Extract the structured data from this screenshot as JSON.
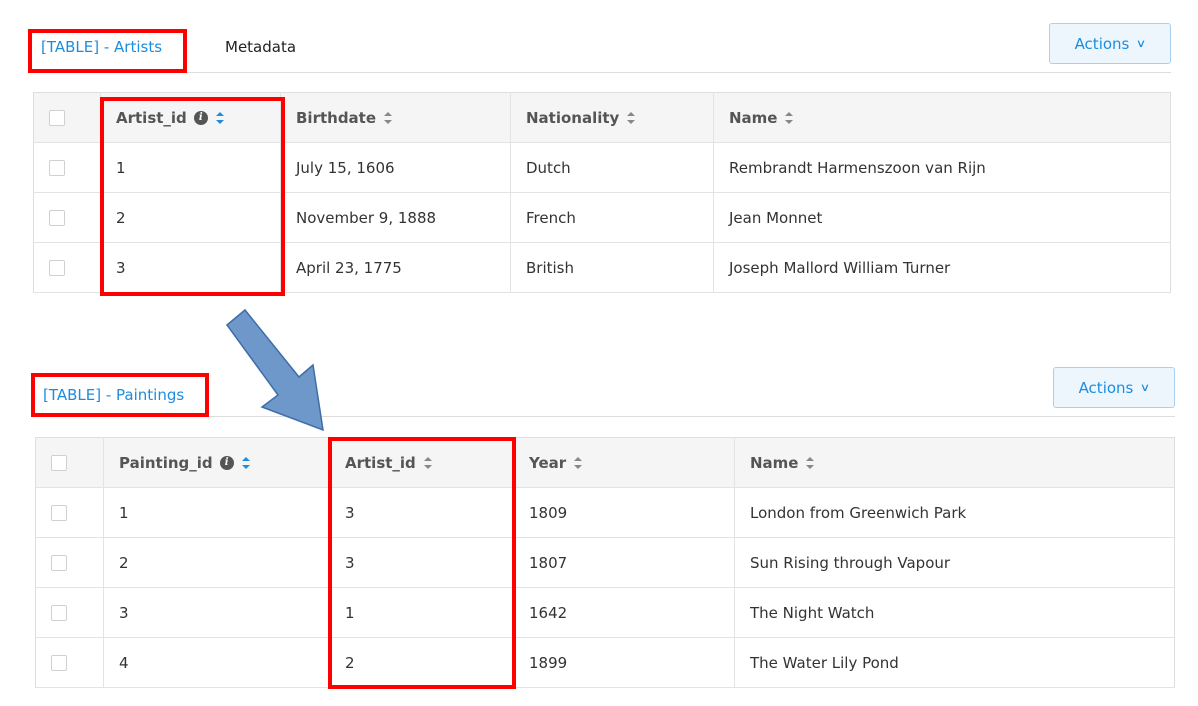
{
  "artists_panel": {
    "tab_active": "[TABLE] - Artists",
    "tab_inactive": "Metadata",
    "actions_label": "Actions",
    "columns": [
      "Artist_id",
      "Birthdate",
      "Nationality",
      "Name"
    ],
    "rows": [
      [
        "1",
        "July 15, 1606",
        "Dutch",
        "Rembrandt Harmenszoon van Rijn"
      ],
      [
        "2",
        "November 9, 1888",
        "French",
        "Jean Monnet"
      ],
      [
        "3",
        "April 23, 1775",
        "British",
        "Joseph Mallord William Turner"
      ]
    ]
  },
  "paintings_panel": {
    "tab_active": "[TABLE] - Paintings",
    "actions_label": "Actions",
    "columns": [
      "Painting_id",
      "Artist_id",
      "Year",
      "Name"
    ],
    "rows": [
      [
        "1",
        "3",
        "1809",
        "London from Greenwich Park"
      ],
      [
        "2",
        "3",
        "1807",
        "Sun Rising through Vapour"
      ],
      [
        "3",
        "1",
        "1642",
        "The Night Watch"
      ],
      [
        "4",
        "2",
        "1899",
        "The Water Lily Pond"
      ]
    ]
  },
  "colors": {
    "accent": "#1b8de0",
    "highlight": "#ff0000",
    "arrow": "#6e98c9"
  },
  "icons": [
    "info-icon",
    "sort-icon",
    "chevron-down-icon",
    "checkbox",
    "arrow-annotation"
  ]
}
